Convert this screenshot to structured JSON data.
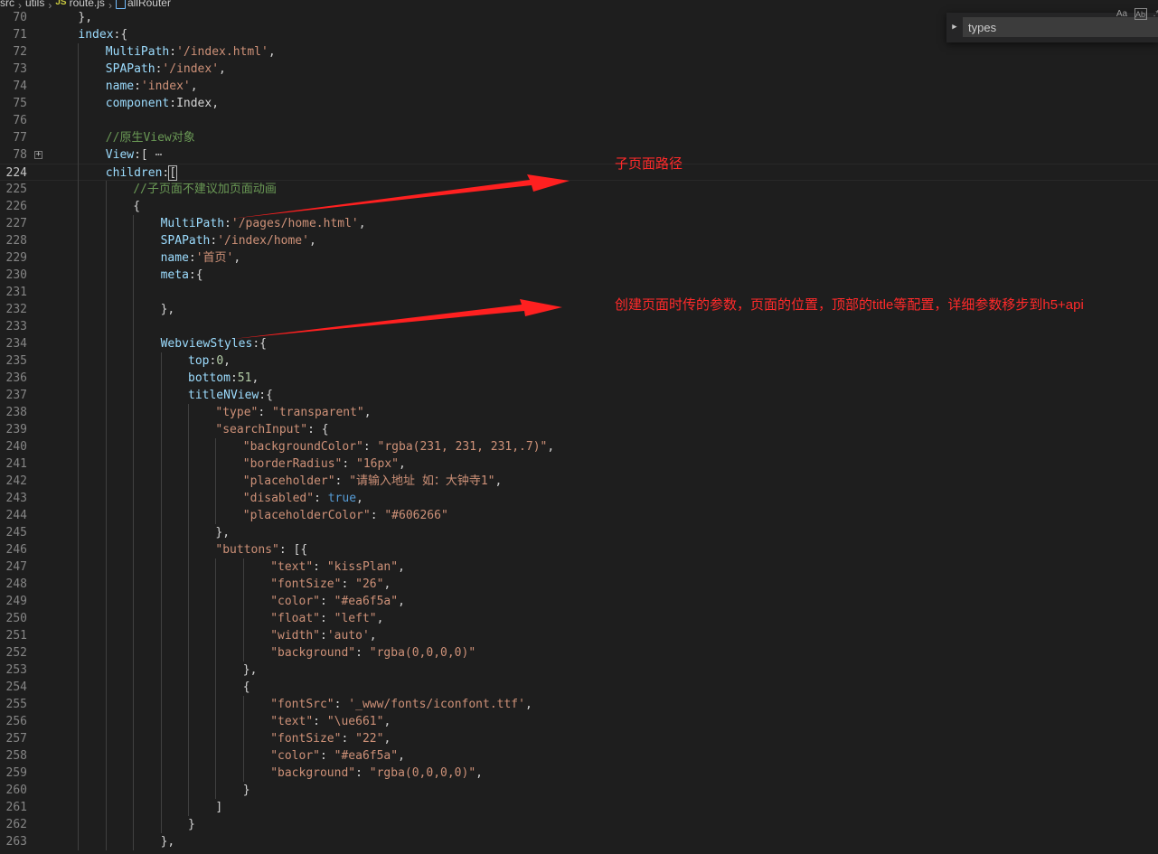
{
  "breadcrumb": {
    "items": [
      "src",
      "utils",
      "route.js",
      "allRouter"
    ],
    "file_icon_text": "JS"
  },
  "find_widget": {
    "value": "types",
    "match_case_label": "Aa",
    "whole_word_label": "Ab|",
    "regex_label": ".*"
  },
  "annotations": {
    "subpage_path": "子页面路径",
    "webview_params": "创建页面时传的参数，页面的位置，顶部的title等配置，详细参数移步到h5+api"
  },
  "colors": {
    "annotation_red": "#ff2a2a",
    "editor_bg": "#1e1e1e",
    "property": "#9cdcfe",
    "string": "#ce9178",
    "number": "#b5cea8",
    "keyword": "#569cd6",
    "comment": "#6a9955"
  },
  "editor": {
    "current_line": "224",
    "fold_icon": "+",
    "lines": [
      {
        "num": "70",
        "indent": 1,
        "tokens": [
          [
            "p",
            "},"
          ]
        ]
      },
      {
        "num": "71",
        "indent": 1,
        "tokens": [
          [
            "k",
            "index"
          ],
          [
            "p",
            ":{"
          ]
        ]
      },
      {
        "num": "72",
        "indent": 2,
        "tokens": [
          [
            "k",
            "MultiPath"
          ],
          [
            "p",
            ":"
          ],
          [
            "s",
            "'/index.html'"
          ],
          [
            "p",
            ","
          ]
        ]
      },
      {
        "num": "73",
        "indent": 2,
        "tokens": [
          [
            "k",
            "SPAPath"
          ],
          [
            "p",
            ":"
          ],
          [
            "s",
            "'/index'"
          ],
          [
            "p",
            ","
          ]
        ]
      },
      {
        "num": "74",
        "indent": 2,
        "tokens": [
          [
            "k",
            "name"
          ],
          [
            "p",
            ":"
          ],
          [
            "s",
            "'index'"
          ],
          [
            "p",
            ","
          ]
        ]
      },
      {
        "num": "75",
        "indent": 2,
        "tokens": [
          [
            "k",
            "component"
          ],
          [
            "p",
            ":Index,"
          ]
        ]
      },
      {
        "num": "76",
        "indent": 2,
        "tokens": []
      },
      {
        "num": "77",
        "indent": 2,
        "tokens": [
          [
            "c",
            "//原生View对象"
          ]
        ]
      },
      {
        "num": "78",
        "indent": 2,
        "fold": true,
        "tokens": [
          [
            "k",
            "View"
          ],
          [
            "p",
            ":["
          ],
          [
            "fd",
            " ⋯"
          ]
        ]
      },
      {
        "num": "224",
        "indent": 2,
        "tokens": [
          [
            "k",
            "children"
          ],
          [
            "p",
            ":"
          ],
          [
            "cur",
            "["
          ]
        ]
      },
      {
        "num": "225",
        "indent": 3,
        "tokens": [
          [
            "c",
            "//子页面不建议加页面动画"
          ]
        ]
      },
      {
        "num": "226",
        "indent": 3,
        "tokens": [
          [
            "p",
            "{"
          ]
        ]
      },
      {
        "num": "227",
        "indent": 4,
        "tokens": [
          [
            "k",
            "MultiPath"
          ],
          [
            "p",
            ":"
          ],
          [
            "s",
            "'/pages/home.html'"
          ],
          [
            "p",
            ","
          ]
        ]
      },
      {
        "num": "228",
        "indent": 4,
        "tokens": [
          [
            "k",
            "SPAPath"
          ],
          [
            "p",
            ":"
          ],
          [
            "s",
            "'/index/home'"
          ],
          [
            "p",
            ","
          ]
        ]
      },
      {
        "num": "229",
        "indent": 4,
        "tokens": [
          [
            "k",
            "name"
          ],
          [
            "p",
            ":"
          ],
          [
            "s",
            "'首页'"
          ],
          [
            "p",
            ","
          ]
        ]
      },
      {
        "num": "230",
        "indent": 4,
        "tokens": [
          [
            "k",
            "meta"
          ],
          [
            "p",
            ":{"
          ]
        ]
      },
      {
        "num": "231",
        "indent": 4,
        "tokens": []
      },
      {
        "num": "232",
        "indent": 4,
        "tokens": [
          [
            "p",
            "},"
          ]
        ]
      },
      {
        "num": "233",
        "indent": 4,
        "tokens": []
      },
      {
        "num": "234",
        "indent": 4,
        "tokens": [
          [
            "k",
            "WebviewStyles"
          ],
          [
            "p",
            ":{"
          ]
        ]
      },
      {
        "num": "235",
        "indent": 5,
        "tokens": [
          [
            "k",
            "top"
          ],
          [
            "p",
            ":"
          ],
          [
            "n",
            "0"
          ],
          [
            "p",
            ","
          ]
        ]
      },
      {
        "num": "236",
        "indent": 5,
        "tokens": [
          [
            "k",
            "bottom"
          ],
          [
            "p",
            ":"
          ],
          [
            "n",
            "51"
          ],
          [
            "p",
            ","
          ]
        ]
      },
      {
        "num": "237",
        "indent": 5,
        "tokens": [
          [
            "k",
            "titleNView"
          ],
          [
            "p",
            ":{"
          ]
        ]
      },
      {
        "num": "238",
        "indent": 6,
        "tokens": [
          [
            "s",
            "\"type\""
          ],
          [
            "p",
            ": "
          ],
          [
            "s",
            "\"transparent\""
          ],
          [
            "p",
            ","
          ]
        ]
      },
      {
        "num": "239",
        "indent": 6,
        "tokens": [
          [
            "s",
            "\"searchInput\""
          ],
          [
            "p",
            ": {"
          ]
        ]
      },
      {
        "num": "240",
        "indent": 7,
        "tokens": [
          [
            "s",
            "\"backgroundColor\""
          ],
          [
            "p",
            ": "
          ],
          [
            "s",
            "\"rgba(231, 231, 231,.7)\""
          ],
          [
            "p",
            ","
          ]
        ]
      },
      {
        "num": "241",
        "indent": 7,
        "tokens": [
          [
            "s",
            "\"borderRadius\""
          ],
          [
            "p",
            ": "
          ],
          [
            "s",
            "\"16px\""
          ],
          [
            "p",
            ","
          ]
        ]
      },
      {
        "num": "242",
        "indent": 7,
        "tokens": [
          [
            "s",
            "\"placeholder\""
          ],
          [
            "p",
            ": "
          ],
          [
            "s",
            "\"请输入地址 如：大钟寺1\""
          ],
          [
            "p",
            ","
          ]
        ]
      },
      {
        "num": "243",
        "indent": 7,
        "tokens": [
          [
            "s",
            "\"disabled\""
          ],
          [
            "p",
            ": "
          ],
          [
            "b",
            "true"
          ],
          [
            "p",
            ","
          ]
        ]
      },
      {
        "num": "244",
        "indent": 7,
        "tokens": [
          [
            "s",
            "\"placeholderColor\""
          ],
          [
            "p",
            ": "
          ],
          [
            "s",
            "\"#606266\""
          ]
        ]
      },
      {
        "num": "245",
        "indent": 6,
        "tokens": [
          [
            "p",
            "},"
          ]
        ]
      },
      {
        "num": "246",
        "indent": 6,
        "tokens": [
          [
            "s",
            "\"buttons\""
          ],
          [
            "p",
            ": [{"
          ]
        ]
      },
      {
        "num": "247",
        "indent": 8,
        "tokens": [
          [
            "s",
            "\"text\""
          ],
          [
            "p",
            ": "
          ],
          [
            "s",
            "\"kissPlan\""
          ],
          [
            "p",
            ","
          ]
        ]
      },
      {
        "num": "248",
        "indent": 8,
        "tokens": [
          [
            "s",
            "\"fontSize\""
          ],
          [
            "p",
            ": "
          ],
          [
            "s",
            "\"26\""
          ],
          [
            "p",
            ","
          ]
        ]
      },
      {
        "num": "249",
        "indent": 8,
        "tokens": [
          [
            "s",
            "\"color\""
          ],
          [
            "p",
            ": "
          ],
          [
            "s",
            "\"#ea6f5a\""
          ],
          [
            "p",
            ","
          ]
        ]
      },
      {
        "num": "250",
        "indent": 8,
        "tokens": [
          [
            "s",
            "\"float\""
          ],
          [
            "p",
            ": "
          ],
          [
            "s",
            "\"left\""
          ],
          [
            "p",
            ","
          ]
        ]
      },
      {
        "num": "251",
        "indent": 8,
        "tokens": [
          [
            "s",
            "\"width\""
          ],
          [
            "p",
            ":"
          ],
          [
            "s",
            "'auto'"
          ],
          [
            "p",
            ","
          ]
        ]
      },
      {
        "num": "252",
        "indent": 8,
        "tokens": [
          [
            "s",
            "\"background\""
          ],
          [
            "p",
            ": "
          ],
          [
            "s",
            "\"rgba(0,0,0,0)\""
          ]
        ]
      },
      {
        "num": "253",
        "indent": 7,
        "tokens": [
          [
            "p",
            "},"
          ]
        ]
      },
      {
        "num": "254",
        "indent": 7,
        "tokens": [
          [
            "p",
            "{"
          ]
        ]
      },
      {
        "num": "255",
        "indent": 8,
        "tokens": [
          [
            "s",
            "\"fontSrc\""
          ],
          [
            "p",
            ": "
          ],
          [
            "s",
            "'_www/fonts/iconfont.ttf'"
          ],
          [
            "p",
            ","
          ]
        ]
      },
      {
        "num": "256",
        "indent": 8,
        "tokens": [
          [
            "s",
            "\"text\""
          ],
          [
            "p",
            ": "
          ],
          [
            "s",
            "\"\\ue661\""
          ],
          [
            "p",
            ","
          ]
        ]
      },
      {
        "num": "257",
        "indent": 8,
        "tokens": [
          [
            "s",
            "\"fontSize\""
          ],
          [
            "p",
            ": "
          ],
          [
            "s",
            "\"22\""
          ],
          [
            "p",
            ","
          ]
        ]
      },
      {
        "num": "258",
        "indent": 8,
        "tokens": [
          [
            "s",
            "\"color\""
          ],
          [
            "p",
            ": "
          ],
          [
            "s",
            "\"#ea6f5a\""
          ],
          [
            "p",
            ","
          ]
        ]
      },
      {
        "num": "259",
        "indent": 8,
        "tokens": [
          [
            "s",
            "\"background\""
          ],
          [
            "p",
            ": "
          ],
          [
            "s",
            "\"rgba(0,0,0,0)\""
          ],
          [
            "p",
            ","
          ]
        ]
      },
      {
        "num": "260",
        "indent": 7,
        "tokens": [
          [
            "p",
            "}"
          ]
        ]
      },
      {
        "num": "261",
        "indent": 6,
        "tokens": [
          [
            "p",
            "]"
          ]
        ]
      },
      {
        "num": "262",
        "indent": 5,
        "tokens": [
          [
            "p",
            "}"
          ]
        ]
      },
      {
        "num": "263",
        "indent": 4,
        "tokens": [
          [
            "p",
            "},"
          ]
        ]
      }
    ]
  }
}
